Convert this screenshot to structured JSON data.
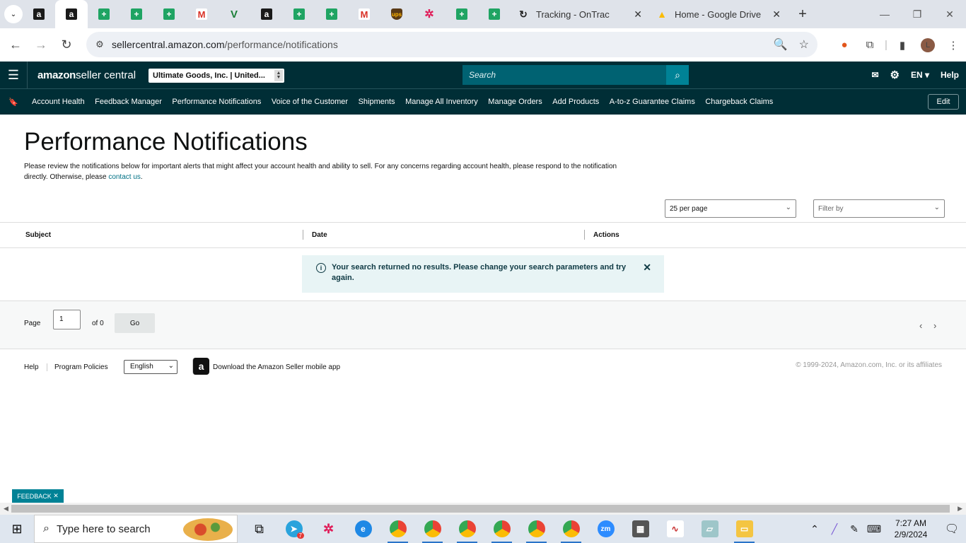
{
  "browser": {
    "tabs": [
      {
        "kind": "amazon",
        "title": ""
      },
      {
        "kind": "amazon",
        "title": "",
        "active": true
      },
      {
        "kind": "sheets",
        "title": ""
      },
      {
        "kind": "sheets",
        "title": ""
      },
      {
        "kind": "sheets",
        "title": ""
      },
      {
        "kind": "gmail",
        "title": ""
      },
      {
        "kind": "v",
        "title": ""
      },
      {
        "kind": "amazon",
        "title": ""
      },
      {
        "kind": "sheets",
        "title": ""
      },
      {
        "kind": "sheets",
        "title": ""
      },
      {
        "kind": "gmail",
        "title": ""
      },
      {
        "kind": "ups",
        "title": ""
      },
      {
        "kind": "slack",
        "title": ""
      },
      {
        "kind": "sheets",
        "title": ""
      },
      {
        "kind": "sheets",
        "title": ""
      }
    ],
    "wide_tabs": [
      {
        "title": "Tracking - OnTrac",
        "icon": "ontrac-icon"
      },
      {
        "title": "Home - Google Drive",
        "icon": "google-drive-icon"
      }
    ],
    "url_host": "sellercentral.amazon.com",
    "url_path": "/performance/notifications",
    "profile_initial": "L"
  },
  "header": {
    "logo_strong": "amazon",
    "logo_rest": " seller central",
    "store": "Ultimate Goods, Inc. | United...",
    "search_placeholder": "Search",
    "language": "EN",
    "help": "Help"
  },
  "nav": {
    "items": [
      "Account Health",
      "Feedback Manager",
      "Performance Notifications",
      "Voice of the Customer",
      "Shipments",
      "Manage All Inventory",
      "Manage Orders",
      "Add Products",
      "A-to-z Guarantee Claims",
      "Chargeback Claims"
    ],
    "edit": "Edit"
  },
  "page": {
    "title": "Performance Notifications",
    "description": "Please review the notifications below for important alerts that might affect your account health and ability to sell. For any concerns regarding account health, please respond to the notification directly. Otherwise, please ",
    "contact_link": "contact us",
    "description_end": ".",
    "per_page": "25 per page",
    "filter_placeholder": "Filter by",
    "columns": [
      "Subject",
      "Date",
      "Actions"
    ],
    "alert": "Your search returned no results. Please change your search parameters and try again.",
    "pager": {
      "page_label": "Page",
      "page_value": "1",
      "of_label": "of 0",
      "go": "Go"
    }
  },
  "footer": {
    "help": "Help",
    "policies": "Program Policies",
    "language": "English",
    "app": "Download the Amazon Seller mobile app",
    "copyright": "© 1999-2024, Amazon.com, Inc. or its affiliates"
  },
  "feedback": "FEEDBACK",
  "taskbar": {
    "search_placeholder": "Type here to search",
    "time": "7:27 AM",
    "date": "2/9/2024",
    "telegram_badge": "7"
  },
  "colors": {
    "header_bg": "#002e36",
    "search_bg": "#006272",
    "accent": "#008296",
    "link": "#007185",
    "alert_bg": "#e8f4f5"
  }
}
